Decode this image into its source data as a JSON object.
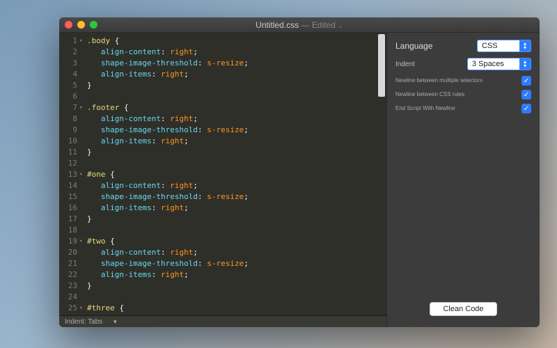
{
  "window": {
    "title": "Untitled.css",
    "edited_label": "Edited"
  },
  "code": {
    "lines": [
      {
        "n": 1,
        "fold": true,
        "tokens": [
          [
            "sel",
            ".body"
          ],
          [
            "punc",
            " {"
          ]
        ]
      },
      {
        "n": 2,
        "fold": false,
        "tokens": [
          [
            "",
            "   "
          ],
          [
            "prop",
            "align-content"
          ],
          [
            "punc",
            ": "
          ],
          [
            "val",
            "right"
          ],
          [
            "punc",
            ";"
          ]
        ]
      },
      {
        "n": 3,
        "fold": false,
        "tokens": [
          [
            "",
            "   "
          ],
          [
            "prop",
            "shape-image-threshold"
          ],
          [
            "punc",
            ": "
          ],
          [
            "val",
            "s-resize"
          ],
          [
            "punc",
            ";"
          ]
        ]
      },
      {
        "n": 4,
        "fold": false,
        "tokens": [
          [
            "",
            "   "
          ],
          [
            "prop",
            "align-items"
          ],
          [
            "punc",
            ": "
          ],
          [
            "val",
            "right"
          ],
          [
            "punc",
            ";"
          ]
        ]
      },
      {
        "n": 5,
        "fold": false,
        "tokens": [
          [
            "punc",
            "}"
          ]
        ]
      },
      {
        "n": 6,
        "fold": false,
        "tokens": []
      },
      {
        "n": 7,
        "fold": true,
        "tokens": [
          [
            "sel",
            ".footer"
          ],
          [
            "punc",
            " {"
          ]
        ]
      },
      {
        "n": 8,
        "fold": false,
        "tokens": [
          [
            "",
            "   "
          ],
          [
            "prop",
            "align-content"
          ],
          [
            "punc",
            ": "
          ],
          [
            "val",
            "right"
          ],
          [
            "punc",
            ";"
          ]
        ]
      },
      {
        "n": 9,
        "fold": false,
        "tokens": [
          [
            "",
            "   "
          ],
          [
            "prop",
            "shape-image-threshold"
          ],
          [
            "punc",
            ": "
          ],
          [
            "val",
            "s-resize"
          ],
          [
            "punc",
            ";"
          ]
        ]
      },
      {
        "n": 10,
        "fold": false,
        "tokens": [
          [
            "",
            "   "
          ],
          [
            "prop",
            "align-items"
          ],
          [
            "punc",
            ": "
          ],
          [
            "val",
            "right"
          ],
          [
            "punc",
            ";"
          ]
        ]
      },
      {
        "n": 11,
        "fold": false,
        "tokens": [
          [
            "punc",
            "}"
          ]
        ]
      },
      {
        "n": 12,
        "fold": false,
        "tokens": []
      },
      {
        "n": 13,
        "fold": true,
        "tokens": [
          [
            "sel",
            "#one"
          ],
          [
            "punc",
            " {"
          ]
        ]
      },
      {
        "n": 14,
        "fold": false,
        "tokens": [
          [
            "",
            "   "
          ],
          [
            "prop",
            "align-content"
          ],
          [
            "punc",
            ": "
          ],
          [
            "val",
            "right"
          ],
          [
            "punc",
            ";"
          ]
        ]
      },
      {
        "n": 15,
        "fold": false,
        "tokens": [
          [
            "",
            "   "
          ],
          [
            "prop",
            "shape-image-threshold"
          ],
          [
            "punc",
            ": "
          ],
          [
            "val",
            "s-resize"
          ],
          [
            "punc",
            ";"
          ]
        ]
      },
      {
        "n": 16,
        "fold": false,
        "tokens": [
          [
            "",
            "   "
          ],
          [
            "prop",
            "align-items"
          ],
          [
            "punc",
            ": "
          ],
          [
            "val",
            "right"
          ],
          [
            "punc",
            ";"
          ]
        ]
      },
      {
        "n": 17,
        "fold": false,
        "tokens": [
          [
            "punc",
            "}"
          ]
        ]
      },
      {
        "n": 18,
        "fold": false,
        "tokens": []
      },
      {
        "n": 19,
        "fold": true,
        "tokens": [
          [
            "sel",
            "#two"
          ],
          [
            "punc",
            " {"
          ]
        ]
      },
      {
        "n": 20,
        "fold": false,
        "tokens": [
          [
            "",
            "   "
          ],
          [
            "prop",
            "align-content"
          ],
          [
            "punc",
            ": "
          ],
          [
            "val",
            "right"
          ],
          [
            "punc",
            ";"
          ]
        ]
      },
      {
        "n": 21,
        "fold": false,
        "tokens": [
          [
            "",
            "   "
          ],
          [
            "prop",
            "shape-image-threshold"
          ],
          [
            "punc",
            ": "
          ],
          [
            "val",
            "s-resize"
          ],
          [
            "punc",
            ";"
          ]
        ]
      },
      {
        "n": 22,
        "fold": false,
        "tokens": [
          [
            "",
            "   "
          ],
          [
            "prop",
            "align-items"
          ],
          [
            "punc",
            ": "
          ],
          [
            "val",
            "right"
          ],
          [
            "punc",
            ";"
          ]
        ]
      },
      {
        "n": 23,
        "fold": false,
        "tokens": [
          [
            "punc",
            "}"
          ]
        ]
      },
      {
        "n": 24,
        "fold": false,
        "tokens": []
      },
      {
        "n": 25,
        "fold": true,
        "tokens": [
          [
            "sel",
            "#three"
          ],
          [
            "punc",
            " {"
          ]
        ]
      }
    ]
  },
  "statusbar": {
    "indent_label": "Indent: Tabs"
  },
  "sidebar": {
    "language_label": "Language",
    "language_value": "CSS",
    "indent_label": "Indent",
    "indent_value": "3 Spaces",
    "checks": [
      {
        "label": "Newline between multiple selectors",
        "checked": true
      },
      {
        "label": "Newline between CSS rules",
        "checked": true
      },
      {
        "label": "End Script With Newline",
        "checked": true
      }
    ],
    "clean_label": "Clean Code"
  }
}
